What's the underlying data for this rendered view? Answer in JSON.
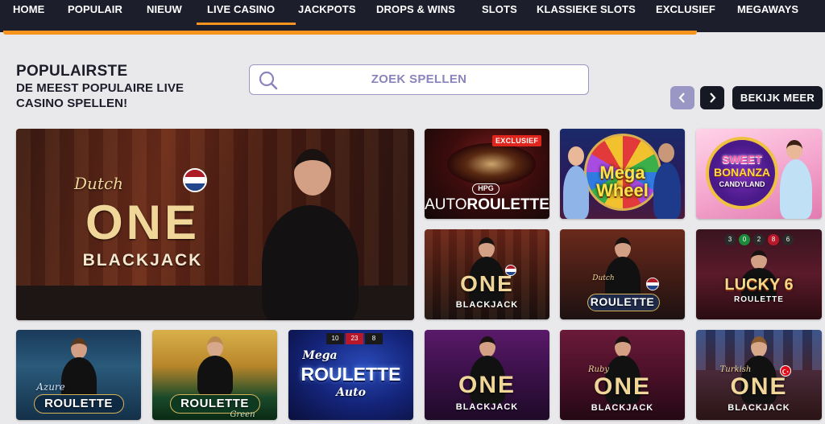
{
  "nav": {
    "items": [
      "HOME",
      "POPULAIR",
      "NIEUW",
      "LIVE CASINO",
      "JACKPOTS",
      "DROPS & WINS",
      "SLOTS",
      "KLASSIEKE SLOTS",
      "EXCLUSIEF",
      "MEGAWAYS"
    ],
    "active": "LIVE CASINO"
  },
  "section": {
    "title": "POPULAIRSTE",
    "subtitle": "DE MEEST POPULAIRE LIVE CASINO SPELLEN!"
  },
  "search": {
    "placeholder": "ZOEK SPELLEN"
  },
  "controls": {
    "see_more": "BEKIJK MEER"
  },
  "games": [
    {
      "name": "Dutch One Blackjack",
      "script": "Dutch",
      "line1": "ONE",
      "line2": "BLACKJACK",
      "flag": "NL"
    },
    {
      "name": "Auto Roulette",
      "badge": "EXCLUSIEF",
      "brand": "HPG",
      "line1": "AUTO",
      "line2": "ROULETTE"
    },
    {
      "name": "Mega Wheel",
      "line1": "Mega",
      "line2": "Wheel"
    },
    {
      "name": "Sweet Bonanza Candyland",
      "line1": "SWEET",
      "line2": "BONANZA",
      "line3": "CANDYLAND"
    },
    {
      "name": "Dutch One Blackjack 2",
      "line1": "ONE",
      "line2": "BLACKJACK",
      "flag": "NL"
    },
    {
      "name": "Dutch Roulette",
      "script": "Dutch",
      "line1": "ROULETTE",
      "flag": "NL"
    },
    {
      "name": "Lucky 6 Roulette",
      "line1": "LUCKY 6",
      "line2": "ROULETTE",
      "numbers": [
        "3",
        "0",
        "2",
        "8",
        "6"
      ]
    },
    {
      "name": "Azure Roulette",
      "script": "Azure",
      "line1": "ROULETTE"
    },
    {
      "name": "Roulette Green",
      "line1": "ROULETTE",
      "script": "Green"
    },
    {
      "name": "Mega Roulette Auto",
      "script": "Mega",
      "line1": "ROULETTE",
      "script2": "Auto",
      "numbers": [
        "10",
        "23",
        "8"
      ]
    },
    {
      "name": "One Blackjack",
      "line1": "ONE",
      "line2": "BLACKJACK"
    },
    {
      "name": "Ruby One Blackjack",
      "script": "Ruby",
      "line1": "ONE",
      "line2": "BLACKJACK"
    },
    {
      "name": "Turkish One Blackjack",
      "script": "Turkish",
      "line1": "ONE",
      "line2": "BLACKJACK",
      "flag": "TR"
    }
  ],
  "colors": {
    "accent": "#f7941d",
    "nav_bg": "#1c1e2b",
    "search_border": "#9a97c4",
    "badge": "#e0261c"
  },
  "icons": [
    "search-icon",
    "chevron-left-icon",
    "chevron-right-icon"
  ]
}
